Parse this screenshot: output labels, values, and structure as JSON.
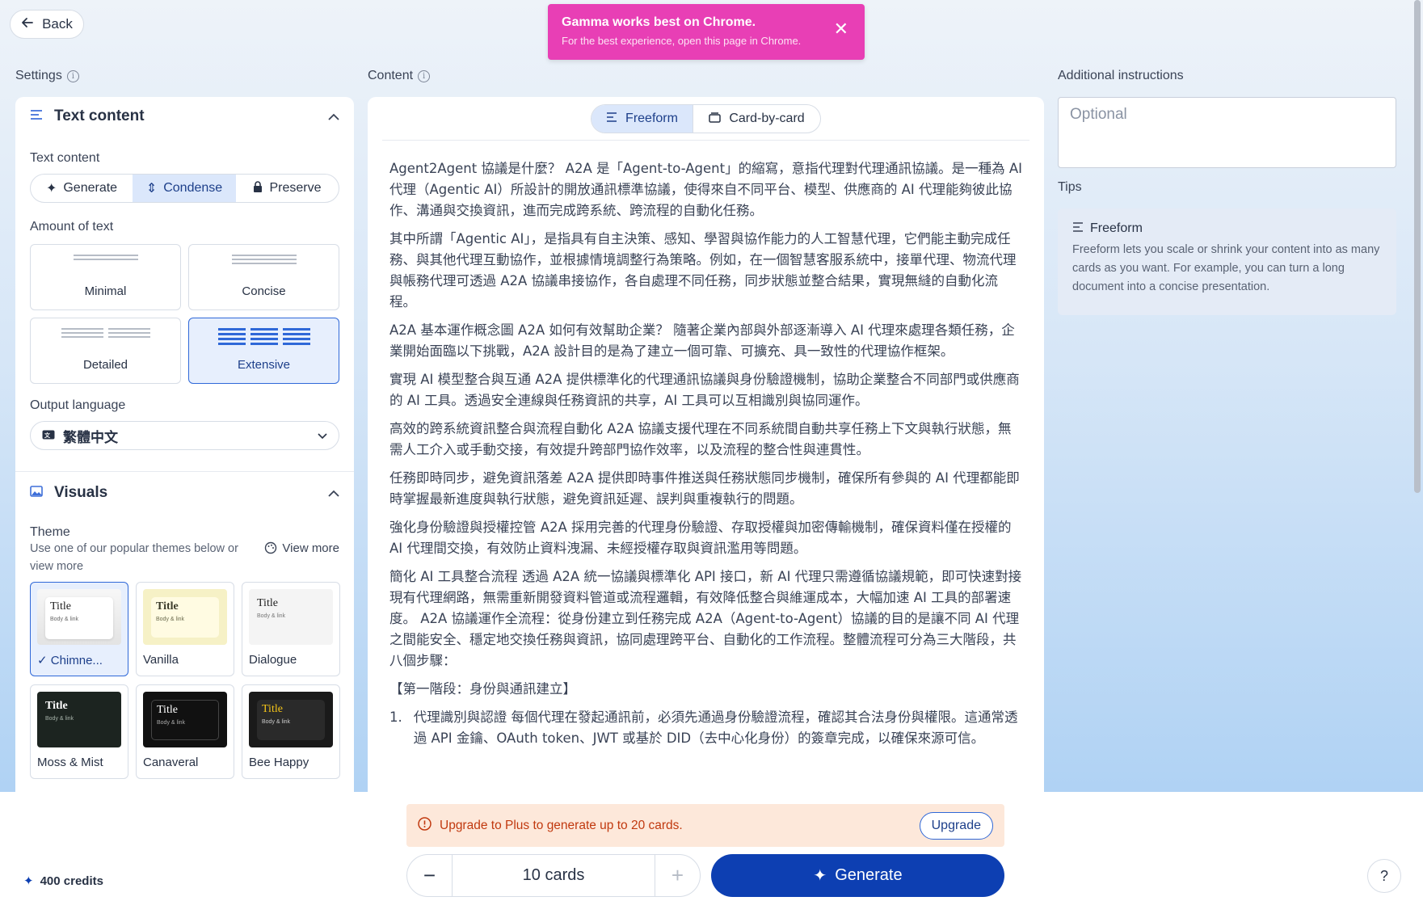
{
  "header": {
    "back_label": "Back"
  },
  "toast": {
    "title": "Gamma works best on Chrome.",
    "message": "For the best experience, open this page in Chrome."
  },
  "labels": {
    "settings": "Settings",
    "content": "Content",
    "additional_instructions": "Additional instructions",
    "tips": "Tips"
  },
  "settings": {
    "text_content_section": "Text content",
    "text_content_label": "Text content",
    "modes": [
      "Generate",
      "Condense",
      "Preserve"
    ],
    "selected_mode": "Condense",
    "amount_label": "Amount of text",
    "amounts": [
      "Minimal",
      "Concise",
      "Detailed",
      "Extensive"
    ],
    "selected_amount": "Extensive",
    "output_language_label": "Output language",
    "output_language": "繁體中文",
    "visuals_section": "Visuals",
    "theme_label": "Theme",
    "theme_desc": "Use one of our popular themes below or view more",
    "view_more": "View more",
    "theme_preview_title": "Title",
    "theme_preview_body": "Body & link",
    "themes": [
      "Chimne...",
      "Vanilla",
      "Dialogue",
      "Moss & Mist",
      "Canaveral",
      "Bee Happy"
    ],
    "selected_theme": "Chimne..."
  },
  "content": {
    "mode_freeform": "Freeform",
    "mode_card": "Card-by-card",
    "paragraphs": [
      "Agent2Agent 協議是什麼？ A2A 是「Agent-to-Agent」的縮寫，意指代理對代理通訊協議。是一種為 AI 代理（Agentic AI）所設計的開放通訊標準協議，使得來自不同平台、模型、供應商的 AI 代理能夠彼此協作、溝通與交換資訊，進而完成跨系統、跨流程的自動化任務。",
      "其中所謂「Agentic AI」，是指具有自主決策、感知、學習與協作能力的人工智慧代理，它們能主動完成任務、與其他代理互動協作，並根據情境調整行為策略。例如，在一個智慧客服系統中，接單代理、物流代理與帳務代理可透過 A2A 協議串接協作，各自處理不同任務，同步狀態並整合結果，實現無縫的自動化流程。",
      "A2A 基本運作概念圖 A2A 如何有效幫助企業？ 隨著企業內部與外部逐漸導入 AI 代理來處理各類任務，企業開始面臨以下挑戰，A2A 設計目的是為了建立一個可靠、可擴充、具一致性的代理協作框架。",
      "實現 AI 模型整合與互通 A2A 提供標準化的代理通訊協議與身份驗證機制，協助企業整合不同部門或供應商的 AI 工具。透過安全連線與任務資訊的共享，AI 工具可以互相識別與協同運作。",
      "高效的跨系統資訊整合與流程自動化 A2A 協議支援代理在不同系統間自動共享任務上下文與執行狀態，無需人工介入或手動交接，有效提升跨部門協作效率，以及流程的整合性與連貫性。",
      "任務即時同步，避免資訊落差 A2A 提供即時事件推送與任務狀態同步機制，確保所有參與的 AI 代理都能即時掌握最新進度與執行狀態，避免資訊延遲、誤判與重複執行的問題。",
      "強化身份驗證與授權控管 A2A 採用完善的代理身份驗證、存取授權與加密傳輸機制，確保資料僅在授權的 AI 代理間交換，有效防止資料洩漏、未經授權存取與資訊濫用等問題。",
      "簡化 AI 工具整合流程 透過 A2A 統一協議與標準化 API 接口，新 AI 代理只需遵循協議規範，即可快速對接現有代理網路，無需重新開發資料管道或流程邏輯，有效降低整合與維運成本，大幅加速 AI 工具的部署速度。 A2A 協議運作全流程：從身份建立到任務完成 A2A（Agent-to-Agent）協議的目的是讓不同 AI 代理之間能安全、穩定地交換任務與資訊，協同處理跨平台、自動化的工作流程。整體流程可分為三大階段，共八個步驟：",
      "【第一階段：身份與通訊建立】"
    ],
    "list_number": "1.",
    "list_item": "代理識別與認證 每個代理在發起通訊前，必須先通過身份驗證流程，確認其合法身份與權限。這通常透過 API 金鑰、OAuth token、JWT 或基於 DID（去中心化身份）的簽章完成，以確保來源可信。"
  },
  "instructions": {
    "placeholder": "Optional"
  },
  "tips": {
    "title": "Freeform",
    "text": "Freeform lets you scale or shrink your content into as many cards as you want. For example, you can turn a long document into a concise presentation."
  },
  "footer": {
    "credits": "400 credits",
    "upgrade_message": "Upgrade to Plus to generate up to 20 cards.",
    "upgrade_button": "Upgrade",
    "card_count": "10 cards",
    "generate_button": "Generate",
    "help": "?"
  },
  "colors": {
    "accent": "#0d3fb2",
    "toast": "#e83fb5",
    "warning_bg": "#fde8da",
    "warning_text": "#c1390f"
  }
}
